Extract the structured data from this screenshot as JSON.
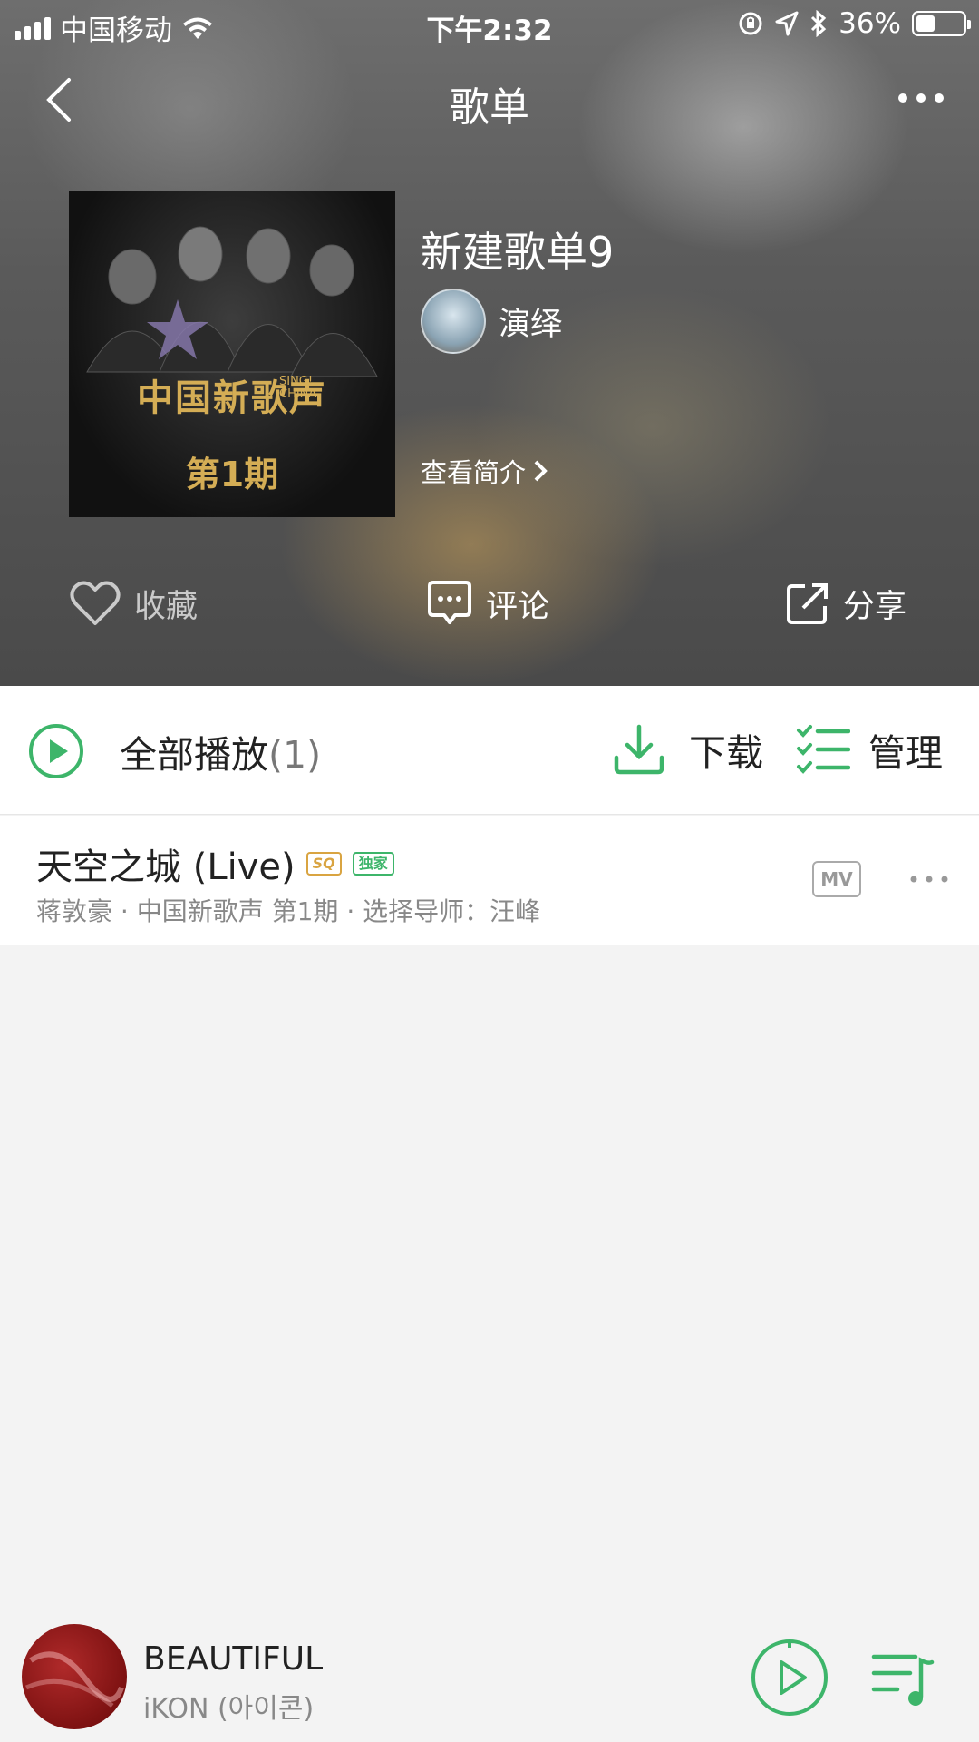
{
  "status_bar": {
    "carrier": "中国移动",
    "time": "下午2:32",
    "battery": "36%"
  },
  "nav": {
    "title": "歌单"
  },
  "playlist": {
    "name": "新建歌单9",
    "creator": "演绎",
    "intro_label": "查看简介",
    "cover": {
      "title_line1": "中国新歌声",
      "title_line2": "第1期",
      "sing_line1": "SING!",
      "sing_line2": "CHINA"
    }
  },
  "actions": {
    "favorite": "收藏",
    "comment": "评论",
    "share": "分享"
  },
  "toolbar": {
    "play_all": "全部播放",
    "count": "(1)",
    "download": "下载",
    "manage": "管理"
  },
  "songs": [
    {
      "title": "天空之城 (Live)",
      "badge_quality": "SQ",
      "badge_exclusive": "独家",
      "subtitle": "蒋敦豪 · 中国新歌声 第1期 · 选择导师：汪峰",
      "mv_label": "MV"
    }
  ],
  "now_playing": {
    "title": "BEAUTIFUL",
    "artist": "iKON (아이콘)"
  },
  "colors": {
    "accent": "#3db56a",
    "badge_gold": "#d9a441"
  }
}
